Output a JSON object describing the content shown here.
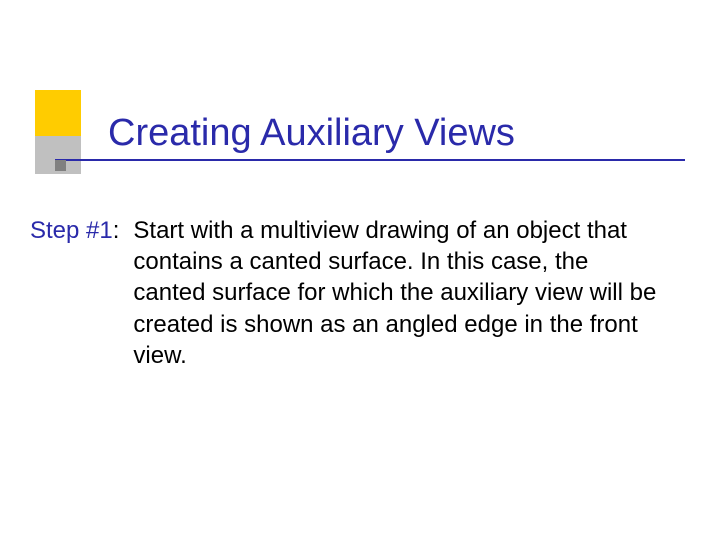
{
  "title": "Creating Auxiliary Views",
  "step_label": "Step #1",
  "step_colon": ":",
  "body_text": "Start with a multiview drawing of an object that contains a canted surface. In this case, the canted surface for which the auxiliary view will be created is shown as an angled edge in the front view."
}
